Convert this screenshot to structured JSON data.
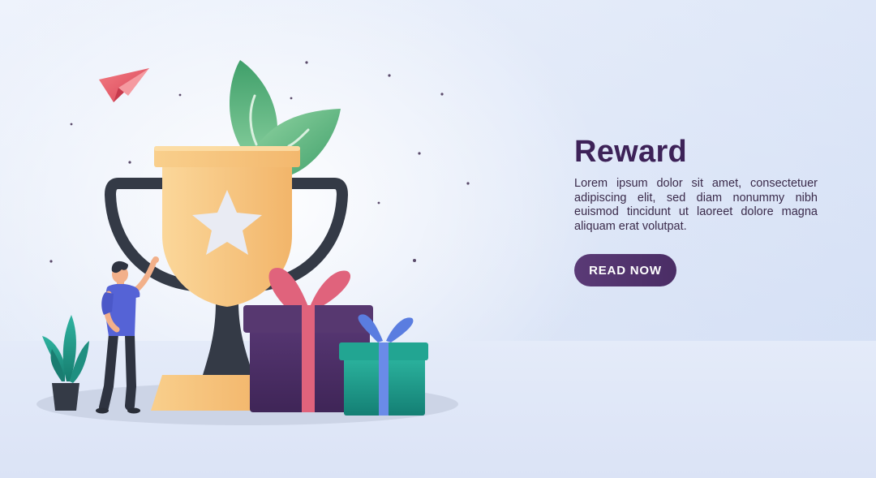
{
  "hero": {
    "title": "Reward",
    "description": "Lorem ipsum dolor sit amet, consectetuer adipiscing elit, sed diam nonummy nibh euismod tincidunt ut laoreet dolore magna aliquam erat volutpat.",
    "button_label": "READ NOW"
  },
  "colors": {
    "title": "#3d2258",
    "button": "#4f3169",
    "trophy": "#f7c77b",
    "trophy_handle": "#343a46",
    "gift_large": "#4a2f63",
    "gift_ribbon": "#e0637c",
    "gift_small": "#1e9a8a",
    "gift_small_ribbon": "#5a7de0",
    "leaves": "#57b27a",
    "paper_plane": "#e85a68"
  },
  "icons": {
    "trophy": "trophy-icon",
    "star": "star-icon",
    "gift_large": "gift-box-icon",
    "gift_small": "gift-box-icon",
    "paper_plane": "paper-plane-icon",
    "plant": "potted-plant-icon",
    "person": "person-icon",
    "leaves": "leaves-icon"
  }
}
